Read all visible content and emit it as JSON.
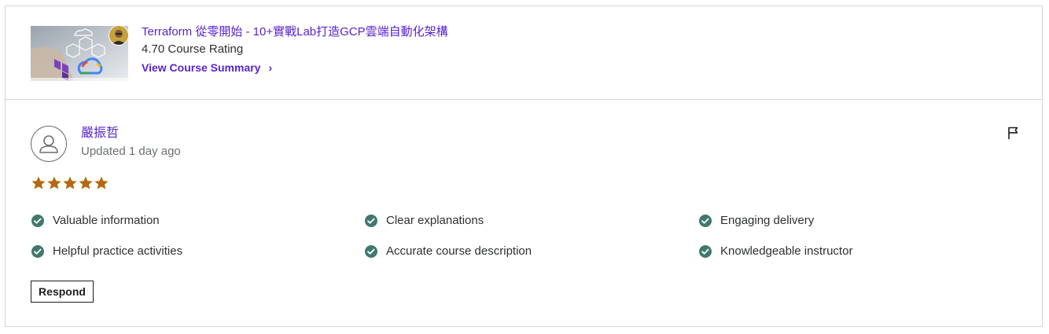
{
  "course": {
    "title": "Terraform 從零開始 - 10+實戰Lab打造GCP雲端自動化架構",
    "rating_text": "4.70 Course Rating",
    "summary_link": "View Course Summary",
    "summary_chevron": "›"
  },
  "review": {
    "reviewer_name": "嚴振哲",
    "updated": "Updated 1 day ago",
    "stars": 5,
    "tags": [
      "Valuable information",
      "Clear explanations",
      "Engaging delivery",
      "Helpful practice activities",
      "Accurate course description",
      "Knowledgeable instructor"
    ],
    "respond_label": "Respond"
  },
  "colors": {
    "link": "#5624d0",
    "star": "#b4690e",
    "check": "#1e6055",
    "border": "#d1d7dc"
  },
  "icons": [
    "course-thumbnail",
    "instructor-avatar",
    "user-icon",
    "flag-icon",
    "star-icon",
    "check-circle-icon",
    "chevron-right-icon"
  ]
}
